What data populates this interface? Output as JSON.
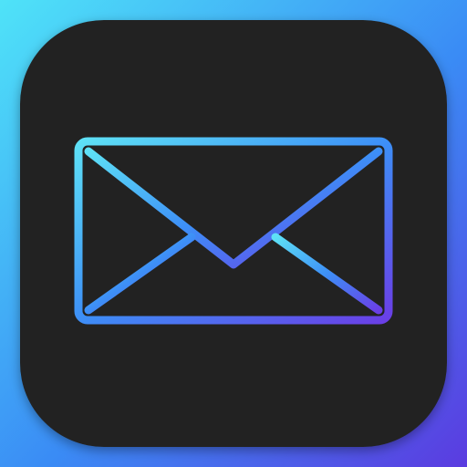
{
  "icon": {
    "name": "mail-envelope-app-icon",
    "glyph": "envelope-icon"
  },
  "colors": {
    "background_start": "#4FE3F8",
    "background_mid": "#3A8BF5",
    "background_end": "#5B3BE0",
    "tile": "#242424",
    "stroke_start": "#5EE1F6",
    "stroke_mid": "#3D8FF7",
    "stroke_end": "#6A3FE6"
  }
}
